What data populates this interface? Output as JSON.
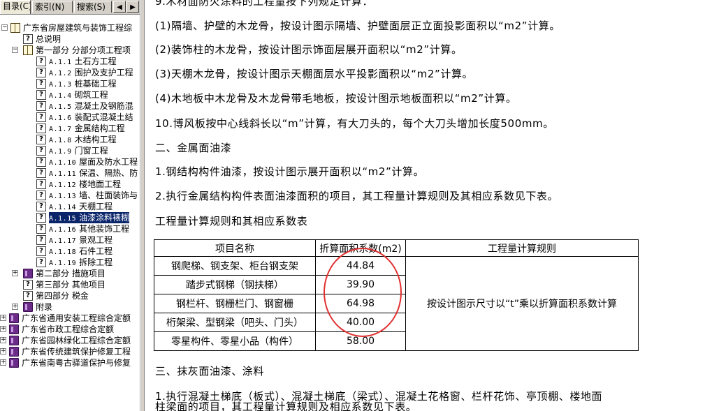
{
  "tabs": {
    "contents": "目录(C)",
    "index": "索引(N)",
    "search": "搜索(S)",
    "prev": "◀",
    "next": "▶"
  },
  "tree": {
    "root": "广东省房屋建筑与装饰工程综",
    "general": "总说明",
    "part1": "第一部分  分部分项工程项",
    "items": [
      {
        "code": "A.1.1",
        "label": "土石方工程"
      },
      {
        "code": "A.1.2",
        "label": "围护及支护工程"
      },
      {
        "code": "A.1.3",
        "label": "桩基础工程"
      },
      {
        "code": "A.1.4",
        "label": "砌筑工程"
      },
      {
        "code": "A.1.5",
        "label": "混凝土及钢筋混"
      },
      {
        "code": "A.1.6",
        "label": "装配式混凝土结"
      },
      {
        "code": "A.1.7",
        "label": "金属结构工程"
      },
      {
        "code": "A.1.8",
        "label": "木结构工程"
      },
      {
        "code": "A.1.9",
        "label": "门窗工程"
      },
      {
        "code": "A.1.10",
        "label": "屋面及防水工程"
      },
      {
        "code": "A.1.11",
        "label": "保温、隔热、防"
      },
      {
        "code": "A.1.12",
        "label": "楼地面工程"
      },
      {
        "code": "A.1.13",
        "label": "墙、柱面装饰与"
      },
      {
        "code": "A.1.14",
        "label": "天棚工程"
      },
      {
        "code": "A.1.15",
        "label": "油漆涂料裱糊"
      },
      {
        "code": "A.1.16",
        "label": "其他装饰工程"
      },
      {
        "code": "A.1.17",
        "label": "景观工程"
      },
      {
        "code": "A.1.18",
        "label": "石件工程"
      },
      {
        "code": "A.1.19",
        "label": "拆除工程"
      }
    ],
    "part2": "第二部分  措施项目",
    "part3": "第三部分  其他项目",
    "part4": "第四部分  税金",
    "appendix": "附录",
    "others": [
      "广东省通用安装工程综合定额",
      "广东省市政工程综合定额",
      "广东省园林绿化工程综合定额",
      "广东省传统建筑保护修复工程",
      "广东省南粤古驿道保护与修复"
    ]
  },
  "content": {
    "p0": "9.木材面防火涂料的工程量按下列规定计算：",
    "p1": "(1)隔墙、护壁的木龙骨，按设计图示隔墙、护壁面层正立面投影面积以“m2”计算。",
    "p2": "(2)装饰柱的木龙骨，按设计图示饰面层展开面积以“m2”计算。",
    "p3": "(3)天棚木龙骨，按设计图示天棚面层水平投影面积以“m2”计算。",
    "p4": "(4)木地板中木龙骨及木龙骨带毛地板，按设计图示地板面积以“m2”计算。",
    "p5": "10.博风板按中心线斜长以“m”计算，有大刀头的，每个大刀头增加长度500mm。",
    "h2": "二、金属面油漆",
    "p6": "1.钢结构构件油漆，按设计图示展开面积以“m2”计算。",
    "p7": "2.执行金属结构构件表面油漆面积的项目，其工程量计算规则及其相应系数见下表。",
    "table_title": "工程量计算规则和其相应系数表",
    "h3": "三、抹灰面油漆、涂料",
    "p8": "1.执行混凝土梯底（板式）、混凝土梯底（梁式）、混凝土花格窗、栏杆花饰、亭顶棚、楼地面",
    "p9": "柱梁面的项目，其工程量计算规则及相应系数见下表。"
  },
  "table": {
    "headers": [
      "项目名称",
      "折算面积系数(m2)",
      "工程量计算规则"
    ],
    "rows": [
      {
        "name": "钢爬梯、钢支架、柜台钢支架",
        "coef": "44.84"
      },
      {
        "name": "踏步式钢梯（钢扶梯）",
        "coef": "39.90"
      },
      {
        "name": "钢栏杆、钢栅栏门、钢窗栅",
        "coef": "64.98"
      },
      {
        "name": "桁架梁、型钢梁（吧头、门头）",
        "coef": "40.00"
      },
      {
        "name": "零星构件、零星小品（构件）",
        "coef": "58.00"
      }
    ],
    "rule": "按设计图示尺寸以“t”乘以折算面积系数计算"
  },
  "colors": {
    "selection": "#0a246a",
    "annotation": "#e03030",
    "chrome": "#d4d0c8"
  }
}
